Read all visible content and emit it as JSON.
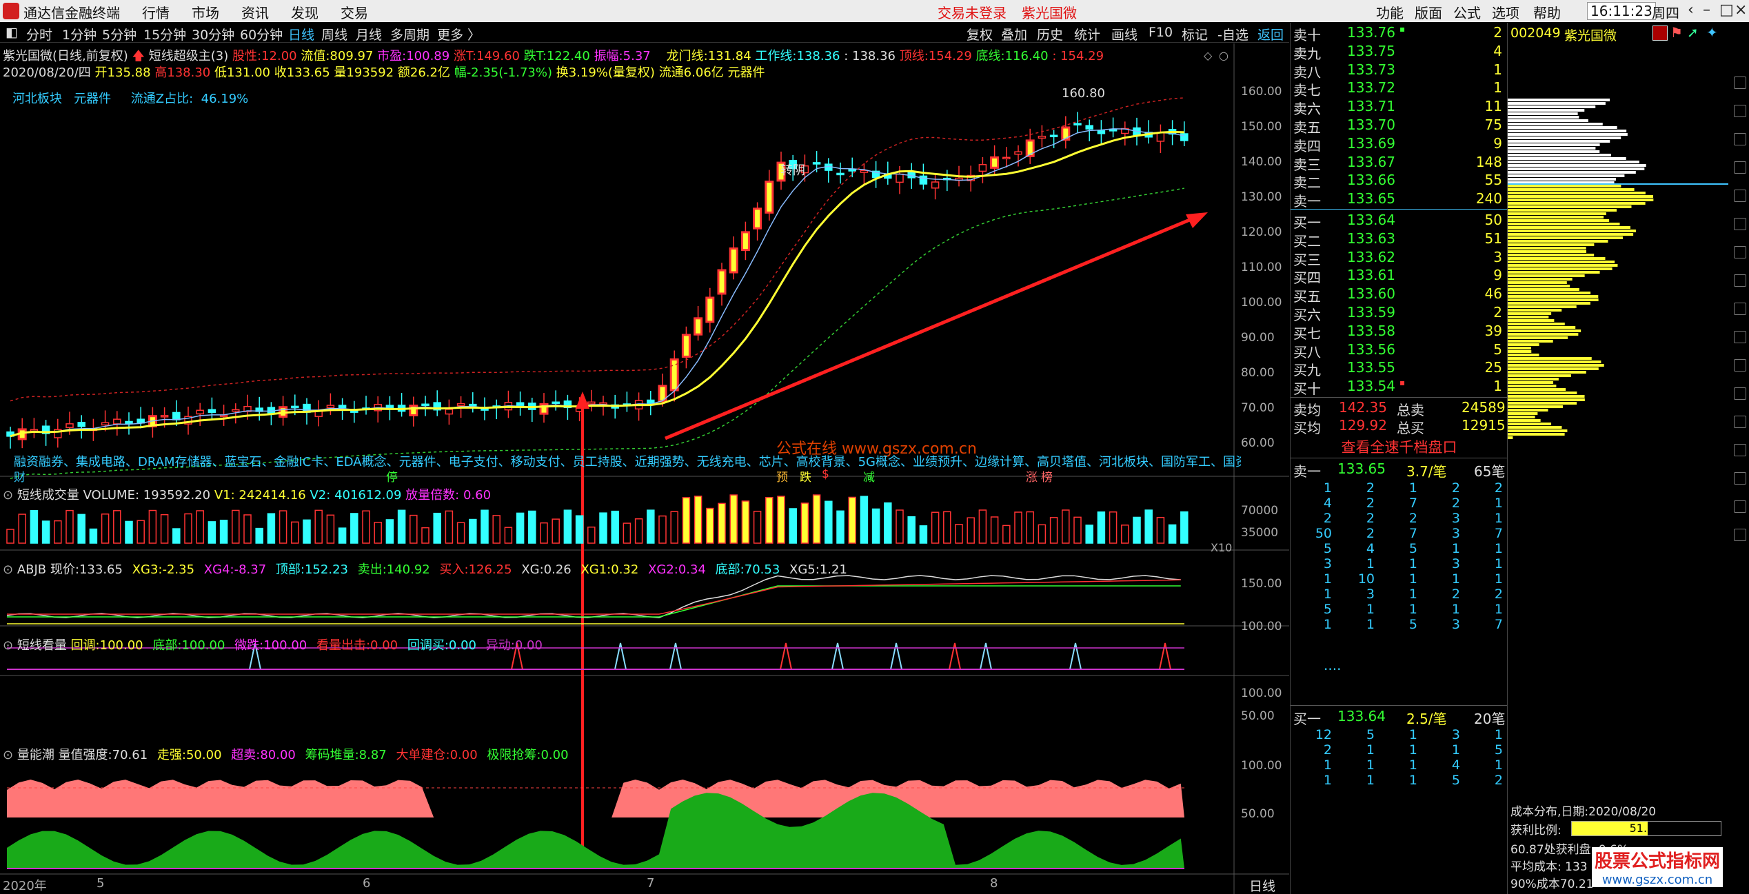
{
  "titlebar": {
    "app_name": "通达信金融终端",
    "menus": [
      "行情",
      "市场",
      "资讯",
      "发现",
      "交易"
    ],
    "status": "交易未登录",
    "stock_name": "紫光国微",
    "right_menus": [
      "功能",
      "版面",
      "公式",
      "选项",
      "帮助"
    ],
    "time": "16:11:23",
    "weekday": "周四"
  },
  "toolbar": {
    "periods": [
      "分时",
      "1分钟",
      "5分钟",
      "15分钟",
      "30分钟",
      "60分钟",
      "日线",
      "周线",
      "月线",
      "多周期",
      "更多 〉"
    ],
    "right_buttons": [
      "复权",
      "叠加",
      "历史",
      "统计",
      "画线",
      "F10",
      "标记",
      "-自选"
    ],
    "return_label": "返回"
  },
  "main_info": {
    "line1_prefix": "紫光国微(日线,前复权)",
    "indicator_name": "短线超级主(3)",
    "pe_label": "股性:",
    "pe_value": "12.00",
    "float_label": "流值:",
    "float_value": "809.97",
    "mktcap_label": "市盈:",
    "mktcap_value": "100.89",
    "up_label": "涨T:",
    "up_value": "149.60",
    "down_label": "跌T:",
    "down_value": "122.40",
    "amp_label": "振幅:",
    "amp_value": "5.37",
    "dragon_label": "龙门线:",
    "dragon_value": "131.84",
    "work_label": "工作线:",
    "work_value": "138.36",
    "work_value2": ": 138.36",
    "top_label": "顶线:",
    "top_value": "154.29",
    "bottom_label": "底线:",
    "bottom_value": "116.40",
    "bottom_value2": ": 154.29",
    "line2": "2020/08/20/四",
    "open_label": "开",
    "open_value": "135.88",
    "high_label": "高",
    "high_value": "138.30",
    "low_label": "低",
    "low_value": "131.00",
    "close_label": "收",
    "close_value": "133.65",
    "vol_label": "量",
    "vol_value": "193592",
    "amt_label": "额",
    "amt_value": "26.2亿",
    "chg_label": "幅",
    "chg_value": "-2.35(-1.73%)",
    "turn_text": "换3.19%(量复权)",
    "float_text": "流通6.06亿",
    "sector_text": "元器件",
    "line3_a": "河北板块",
    "line3_b": "元器件",
    "line3_c": "流通Z占比:",
    "line3_d": "46.19%"
  },
  "price_axis": [
    "160.00",
    "150.00",
    "140.00",
    "130.00",
    "120.00",
    "110.00",
    "100.00",
    "90.00",
    "80.00",
    "70.00",
    "60.00"
  ],
  "annotations": {
    "peak": "160.80",
    "turn": "转阴",
    "watermark": "公式在线 www.gszx.com.cn",
    "concepts": "融资融券、集成电路、DRAM存储器、蓝宝石、金融IC卡、EDA概念、元器件、电子支付、移动支付、员工持股、近期强势、无线充电、芯片、高校背景、5G概念、业绩预升、边缘计算、高贝塔值、河北板块、国防军工、国资",
    "labels": [
      "财",
      "停",
      "预",
      "跌",
      "$",
      "减",
      "涨",
      "榜"
    ]
  },
  "volume_panel": {
    "title": "短线成交量",
    "vol_label": "VOLUME:",
    "vol_value": "193592.20",
    "v1_label": "V1:",
    "v1_value": "242414.16",
    "v2_label": "V2:",
    "v2_value": "401612.09",
    "ratio_label": "放量倍数:",
    "ratio_value": "0.60",
    "axis": [
      "70000",
      "35000"
    ],
    "unit": "X10"
  },
  "abjb_panel": {
    "title": "ABJB",
    "items": [
      {
        "label": "现价:",
        "value": "133.65",
        "color": "#dddddd"
      },
      {
        "label": "XG3:",
        "value": "-2.35",
        "color": "#ffff33"
      },
      {
        "label": "XG4:",
        "value": "-8.37",
        "color": "#ff33ff"
      },
      {
        "label": "顶部:",
        "value": "152.23",
        "color": "#33ffff"
      },
      {
        "label": "卖出:",
        "value": "140.92",
        "color": "#33ff33"
      },
      {
        "label": "买入:",
        "value": "126.25",
        "color": "#ff3333"
      },
      {
        "label": "XG:",
        "value": "0.26",
        "color": "#dddddd"
      },
      {
        "label": "XG1:",
        "value": "0.32",
        "color": "#ffff33"
      },
      {
        "label": "XG2:",
        "value": "0.34",
        "color": "#ff33ff"
      },
      {
        "label": "底部:",
        "value": "70.53",
        "color": "#33ffff"
      },
      {
        "label": "XG5:",
        "value": "1.21",
        "color": "#dddddd"
      }
    ],
    "axis": [
      "150.00",
      "100.00"
    ]
  },
  "kanzhang_panel": {
    "title": "短线看量",
    "items": [
      {
        "label": "回调:",
        "value": "100.00",
        "color": "#ffff33"
      },
      {
        "label": "底部:",
        "value": "100.00",
        "color": "#33ff33"
      },
      {
        "label": "微跌:",
        "value": "100.00",
        "color": "#ff33ff"
      },
      {
        "label": "看量出击:",
        "value": "0.00",
        "color": "#ff3333"
      },
      {
        "label": "回调买:",
        "value": "0.00",
        "color": "#33ffff"
      },
      {
        "label": "异动:",
        "value": "0.00",
        "color": "#cc33cc"
      }
    ],
    "axis": [
      "100.00",
      "50.00"
    ]
  },
  "energy_panel": {
    "title": "量能潮",
    "items": [
      {
        "label": "量值强度:",
        "value": "70.61",
        "color": "#dddddd"
      },
      {
        "label": "走强:",
        "value": "50.00",
        "color": "#ffff33"
      },
      {
        "label": "超卖:",
        "value": "80.00",
        "color": "#ff33ff"
      },
      {
        "label": "筹码堆量:",
        "value": "8.87",
        "color": "#33ff33"
      },
      {
        "label": "大单建仓:",
        "value": "0.00",
        "color": "#ff3333"
      },
      {
        "label": "极限抢筹:",
        "value": "0.00",
        "color": "#33ff33"
      }
    ],
    "axis": [
      "100.00",
      "50.00"
    ]
  },
  "date_axis": {
    "year": "2020年",
    "months": [
      "5",
      "6",
      "7",
      "8"
    ],
    "period": "日线"
  },
  "order_book": {
    "sell": [
      {
        "label": "卖十",
        "price": "133.76",
        "vol": "2",
        "mark": "s"
      },
      {
        "label": "卖九",
        "price": "133.75",
        "vol": "4",
        "mark": ""
      },
      {
        "label": "卖八",
        "price": "133.73",
        "vol": "1",
        "mark": ""
      },
      {
        "label": "卖七",
        "price": "133.72",
        "vol": "1",
        "mark": ""
      },
      {
        "label": "卖六",
        "price": "133.71",
        "vol": "11",
        "mark": ""
      },
      {
        "label": "卖五",
        "price": "133.70",
        "vol": "75",
        "mark": ""
      },
      {
        "label": "卖四",
        "price": "133.69",
        "vol": "9",
        "mark": ""
      },
      {
        "label": "卖三",
        "price": "133.67",
        "vol": "148",
        "mark": ""
      },
      {
        "label": "卖二",
        "price": "133.66",
        "vol": "55",
        "mark": ""
      },
      {
        "label": "卖一",
        "price": "133.65",
        "vol": "240",
        "mark": ""
      }
    ],
    "buy": [
      {
        "label": "买一",
        "price": "133.64",
        "vol": "50",
        "mark": ""
      },
      {
        "label": "买二",
        "price": "133.63",
        "vol": "51",
        "mark": ""
      },
      {
        "label": "买三",
        "price": "133.62",
        "vol": "3",
        "mark": ""
      },
      {
        "label": "买四",
        "price": "133.61",
        "vol": "9",
        "mark": ""
      },
      {
        "label": "买五",
        "price": "133.60",
        "vol": "46",
        "mark": ""
      },
      {
        "label": "买六",
        "price": "133.59",
        "vol": "2",
        "mark": ""
      },
      {
        "label": "买七",
        "price": "133.58",
        "vol": "39",
        "mark": ""
      },
      {
        "label": "买八",
        "price": "133.56",
        "vol": "5",
        "mark": ""
      },
      {
        "label": "买九",
        "price": "133.55",
        "vol": "25",
        "mark": ""
      },
      {
        "label": "买十",
        "price": "133.54",
        "vol": "1",
        "mark": "s"
      }
    ],
    "avg_sell_label": "卖均",
    "avg_sell": "142.35",
    "total_sell_label": "总卖",
    "total_sell": "24589",
    "avg_buy_label": "买均",
    "avg_buy": "129.92",
    "total_buy_label": "总买",
    "total_buy": "12915",
    "link": "查看全速千档盘口"
  },
  "queue_sell": {
    "label": "卖一",
    "price": "133.65",
    "per": "3.7/笔",
    "count": "65笔",
    "rows": [
      [
        "1",
        "2",
        "1",
        "2",
        "2"
      ],
      [
        "4",
        "2",
        "7",
        "2",
        "1"
      ],
      [
        "2",
        "2",
        "2",
        "3",
        "1"
      ],
      [
        "50",
        "2",
        "7",
        "3",
        "7"
      ],
      [
        "5",
        "4",
        "5",
        "1",
        "1"
      ],
      [
        "3",
        "1",
        "1",
        "3",
        "1"
      ],
      [
        "1",
        "10",
        "1",
        "1",
        "1"
      ],
      [
        "1",
        "3",
        "1",
        "2",
        "2"
      ],
      [
        "5",
        "1",
        "1",
        "1",
        "1"
      ],
      [
        "1",
        "1",
        "5",
        "3",
        "7"
      ]
    ],
    "more": "...."
  },
  "queue_buy": {
    "label": "买一",
    "price": "133.64",
    "per": "2.5/笔",
    "count": "20笔",
    "rows": [
      [
        "12",
        "5",
        "1",
        "3",
        "1"
      ],
      [
        "2",
        "1",
        "1",
        "1",
        "5"
      ],
      [
        "1",
        "1",
        "1",
        "4",
        "1"
      ],
      [
        "1",
        "1",
        "1",
        "5",
        "2"
      ]
    ]
  },
  "profile": {
    "code": "002049",
    "name": "紫光国微",
    "dist_label": "成本分布,日期:",
    "dist_date": "2020/08/20",
    "profit_label": "获利比例:",
    "profit_value": "51.0%",
    "profit_fill": 0.51,
    "line3": "60.87处获利盘: 0.6%",
    "line4": "平均成本: 133",
    "line5": "90%成本70.21",
    "watermark1": "股票公式指标网",
    "watermark2": "www.gszx.com.cn"
  },
  "colors": {
    "up": "#ff3333",
    "down": "#33ffff",
    "ma_yellow": "#ffff33",
    "accent": "#3fc4ff"
  }
}
